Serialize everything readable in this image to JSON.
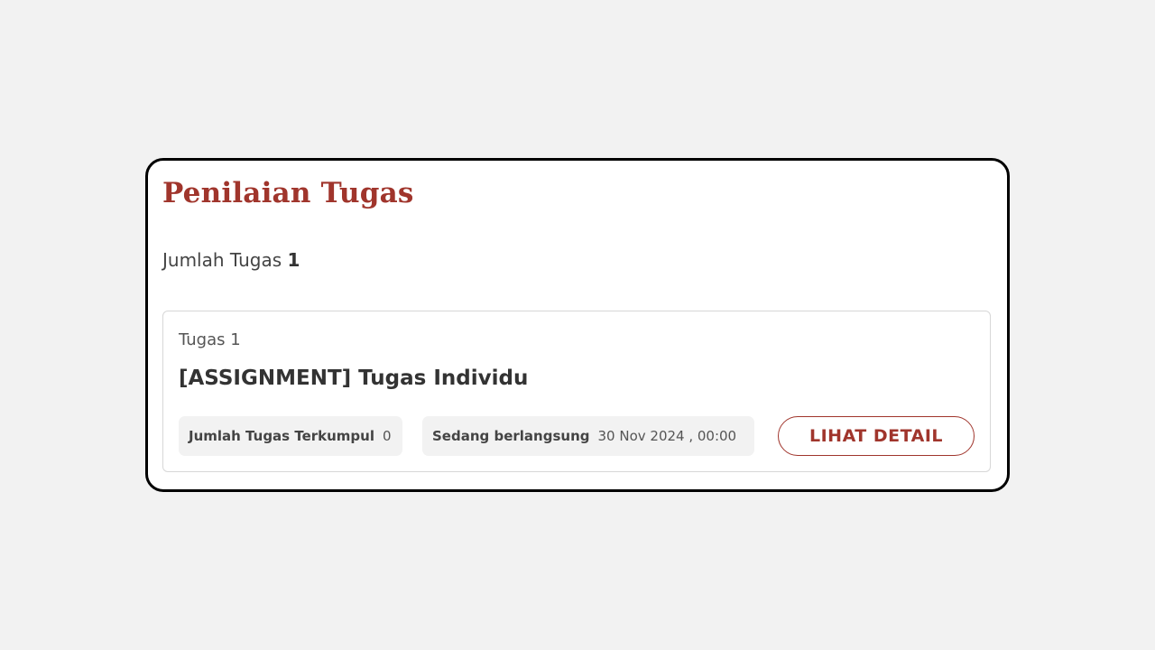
{
  "header": {
    "title": "Penilaian Tugas"
  },
  "summary": {
    "label": "Jumlah Tugas",
    "count": "1"
  },
  "tasks": [
    {
      "number_label": "Tugas 1",
      "title": "[ASSIGNMENT] Tugas Individu",
      "collected_label": "Jumlah Tugas Terkumpul",
      "collected_value": "0",
      "status_label": "Sedang berlangsung",
      "status_value": "30 Nov 2024 , 00:00",
      "button_label": "LIHAT DETAIL"
    }
  ],
  "colors": {
    "accent": "#a0352c",
    "panel_border": "#000000",
    "background": "#f2f2f2",
    "chip_background": "#f2f2f2"
  }
}
